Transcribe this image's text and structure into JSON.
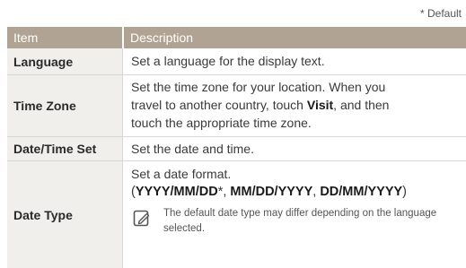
{
  "default_note": "* Default",
  "table": {
    "header_item": "Item",
    "header_desc": "Description",
    "rows": [
      {
        "item": "Language",
        "desc": "Set a language for the display text."
      },
      {
        "item": "Time Zone",
        "desc_line1": "Set the time zone for your location. When you",
        "desc_line2_pre": "travel to another country, touch ",
        "desc_line2_bold": "Visit",
        "desc_line2_post": ", and then",
        "desc_line3": "touch the appropriate time zone."
      },
      {
        "item": "Date/Time Set",
        "desc": "Set the date and time."
      },
      {
        "item": "Date Type",
        "desc_line1": "Set a date format.",
        "open_paren": "(",
        "format1": "YYYY/MM/DD",
        "asterisk": "*",
        "sep1": ", ",
        "format2": "MM/DD/YYYY",
        "sep2": ", ",
        "format3": "DD/MM/YYYY",
        "close_paren": ")",
        "note": "The default date type may differ depending on the language selected."
      }
    ]
  },
  "icons": {
    "note": "note-pencil-icon"
  },
  "colors": {
    "header_bg": "#b0a393",
    "item_cell_bg": "#f1efec",
    "border": "#d7d7d7"
  }
}
